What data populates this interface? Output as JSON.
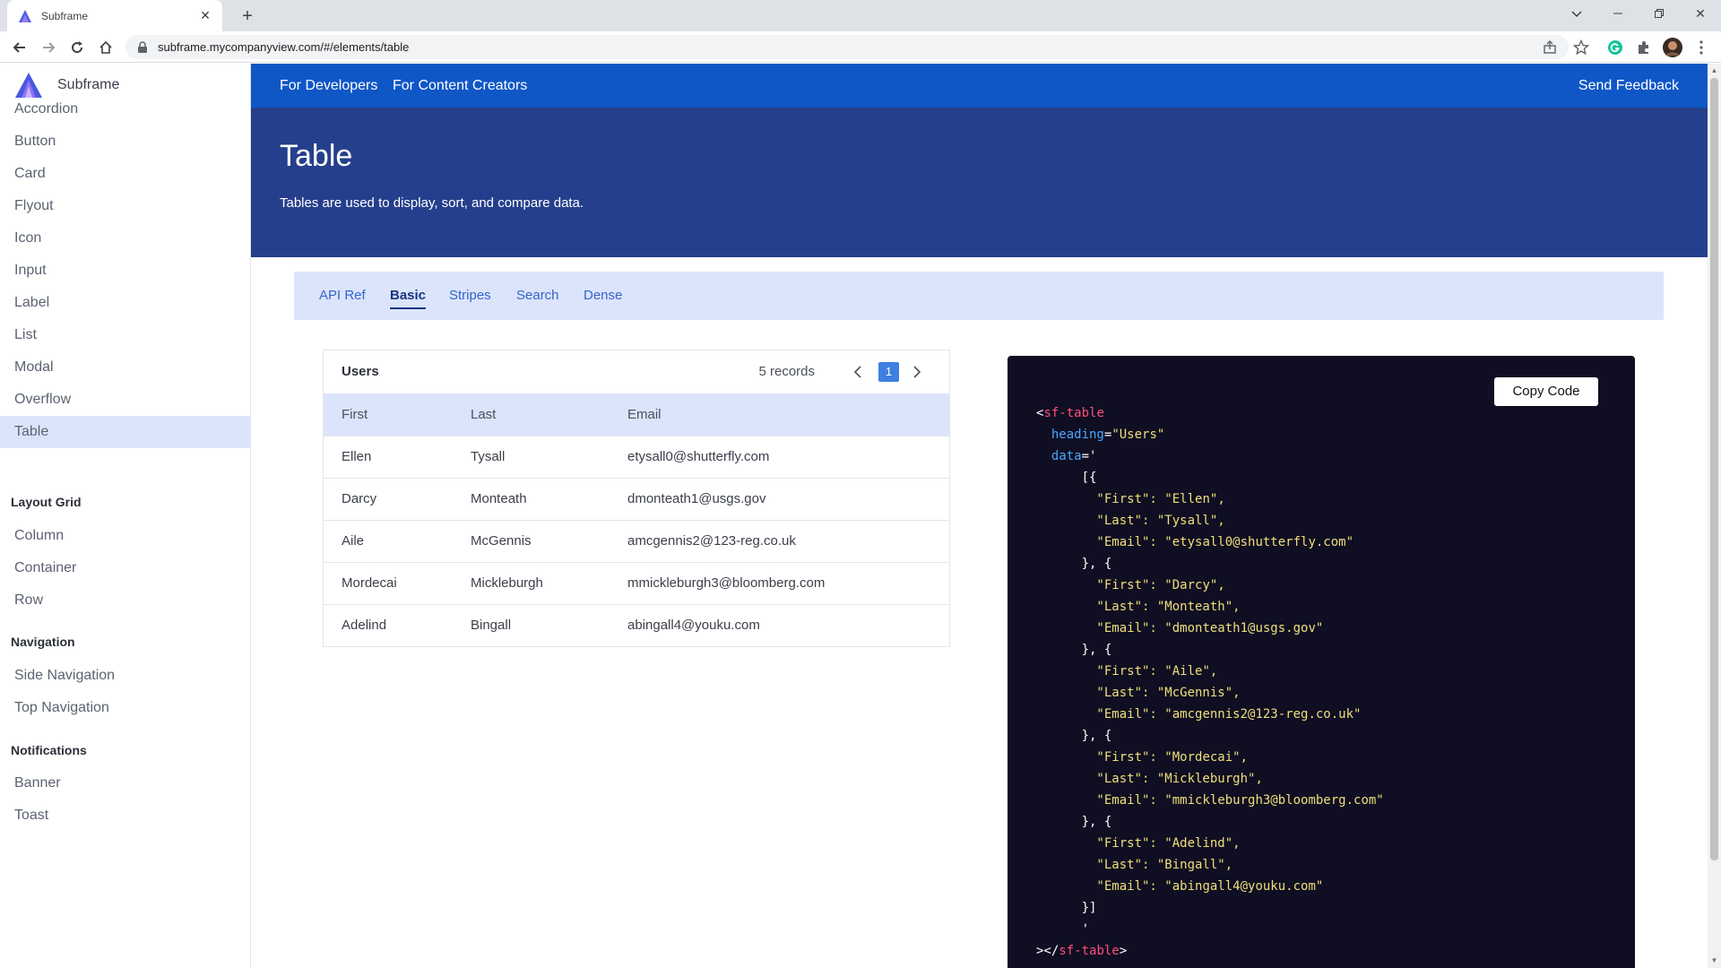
{
  "browser": {
    "tab_title": "Subframe",
    "url": "subframe.mycompanyview.com/#/elements/table"
  },
  "sidebar": {
    "brand": "Subframe",
    "items": [
      "Accordion",
      "Button",
      "Card",
      "Flyout",
      "Icon",
      "Input",
      "Label",
      "List",
      "Modal",
      "Overflow",
      "Table"
    ],
    "active_item": "Table",
    "sections": [
      {
        "title": "Layout Grid",
        "items": [
          "Column",
          "Container",
          "Row"
        ]
      },
      {
        "title": "Navigation",
        "items": [
          "Side Navigation",
          "Top Navigation"
        ]
      },
      {
        "title": "Notifications",
        "items": [
          "Banner",
          "Toast"
        ]
      }
    ]
  },
  "topnav": {
    "developers": "For Developers",
    "creators": "For Content Creators",
    "feedback": "Send Feedback"
  },
  "hero": {
    "title": "Table",
    "description": "Tables are used to display, sort, and compare data."
  },
  "tabs": [
    "API Ref",
    "Basic",
    "Stripes",
    "Search",
    "Dense"
  ],
  "active_tab": "Basic",
  "table": {
    "heading": "Users",
    "records_label": "5 records",
    "page": "1",
    "columns": [
      "First",
      "Last",
      "Email"
    ],
    "rows": [
      [
        "Ellen",
        "Tysall",
        "etysall0@shutterfly.com"
      ],
      [
        "Darcy",
        "Monteath",
        "dmonteath1@usgs.gov"
      ],
      [
        "Aile",
        "McGennis",
        "amcgennis2@123-reg.co.uk"
      ],
      [
        "Mordecai",
        "Micklebурgh",
        "mmickleburgh3@bloomberg.com"
      ],
      [
        "Adelind",
        "Bingall",
        "abingall4@youku.com"
      ]
    ]
  },
  "code": {
    "copy_label": "Copy Code",
    "tag": "sf-table",
    "heading_attr": "heading",
    "heading_value": "\"Users\"",
    "data_attr": "data",
    "entries": [
      {
        "first": "\"Ellen\"",
        "last": "\"Tysall\"",
        "email": "\"etysall0@shutterfly.com\""
      },
      {
        "first": "\"Darcy\"",
        "last": "\"Monteath\"",
        "email": "\"dmonteath1@usgs.gov\""
      },
      {
        "first": "\"Aile\"",
        "last": "\"McGennis\"",
        "email": "\"amcgennis2@123-reg.co.uk\""
      },
      {
        "first": "\"Mordecai\"",
        "last": "\"Mickleburgh\"",
        "email": "\"mmickleburgh3@bloomberg.com\""
      },
      {
        "first": "\"Adelind\"",
        "last": "\"Bingall\"",
        "email": "\"abingall4@youku.com\""
      }
    ]
  },
  "colors": {
    "topnav": "#0f57c6",
    "hero": "#253f8c",
    "accent_light": "#dbe4fb",
    "code_bg": "#0f0e22",
    "page_badge": "#3f7fe0"
  },
  "icons": {
    "tab_favicon": "subframe-logo-icon",
    "tab_close": "close-icon",
    "new_tab": "plus-icon",
    "back": "arrow-left-icon",
    "forward": "arrow-right-icon",
    "reload": "reload-icon",
    "home": "home-icon",
    "lock": "lock-icon",
    "share": "share-icon",
    "bookmark": "star-icon",
    "extension_grammarly": "grammarly-icon",
    "extensions": "puzzle-icon",
    "profile": "avatar",
    "menu": "kebab-menu-icon",
    "prev_page": "chevron-left-icon",
    "next_page": "chevron-right-icon"
  }
}
